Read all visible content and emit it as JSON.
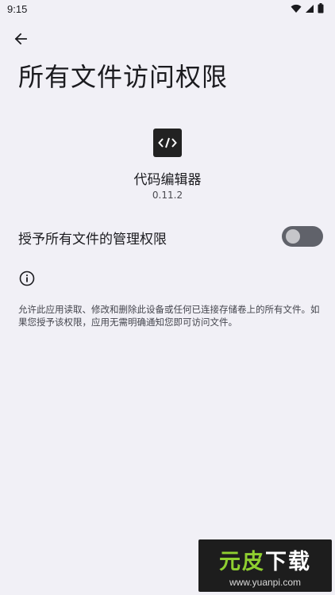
{
  "status_bar": {
    "time": "9:15",
    "icons": [
      "wifi-icon",
      "signal-icon",
      "battery-icon"
    ]
  },
  "header": {
    "back_icon": "arrow-back-icon",
    "title": "所有文件访问权限"
  },
  "app": {
    "icon": "code-icon",
    "name": "代码编辑器",
    "version": "0.11.2"
  },
  "permission": {
    "label": "授予所有文件的管理权限",
    "enabled": false
  },
  "info": {
    "icon": "info-icon",
    "description": "允许此应用读取、修改和删除此设备或任何已连接存储卷上的所有文件。如果您授予该权限，应用无需明确通知您即可访问文件。"
  },
  "watermark": {
    "logo_part1": "元",
    "logo_part2": "皮",
    "logo_part3": "下",
    "logo_part4": "载",
    "url": "www.yuanpi.com"
  },
  "colors": {
    "background": "#f1f0f6",
    "toggle_track": "#60626a",
    "toggle_knob": "#c6c6ca",
    "watermark_green": "#8fcf30"
  }
}
